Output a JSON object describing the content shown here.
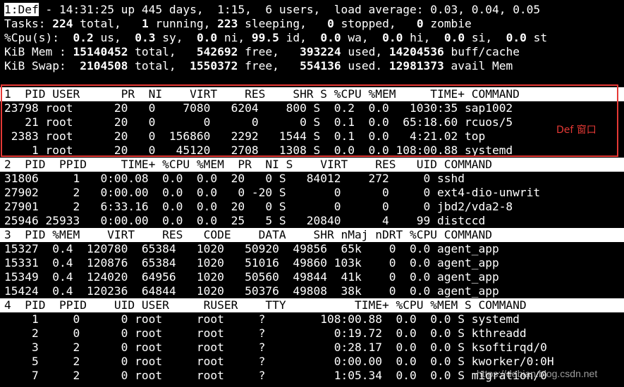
{
  "summary": {
    "top_tag": "1:Def",
    "top_rest": " - 14:31:25 up 445 days,  1:15,  6 users,  load average: 0.03, 0.04, 0.05",
    "tasks": [
      "Tasks: ",
      "224",
      " total,   ",
      "1",
      " running, ",
      "223",
      " sleeping,   ",
      "0",
      " stopped,   ",
      "0",
      " zombie"
    ],
    "cpu": [
      "%Cpu(s):  ",
      "0.2",
      " us,  ",
      "0.3",
      " sy,  ",
      "0.0",
      " ni, ",
      "99.5",
      " id,  ",
      "0.0",
      " wa,  ",
      "0.0",
      " hi,  ",
      "0.0",
      " si,  ",
      "0.0",
      " st"
    ],
    "mem": [
      "KiB Mem : ",
      "15140452",
      " total,   ",
      "542692",
      " free,   ",
      "393224",
      " used, ",
      "14204536",
      " buff/cache"
    ],
    "swap": [
      "KiB Swap:  ",
      "2104508",
      " total,  ",
      "1550372",
      " free,   ",
      "554136",
      " used. ",
      "12981373",
      " avail Mem"
    ]
  },
  "windows": [
    {
      "header": "1  PID USER      PR  NI    VIRT    RES    SHR S %CPU %MEM     TIME+ COMMAND",
      "rows": [
        "23798 root      20   0    7080   6204    800 S  0.2  0.0   1030:35 sap1002",
        "   21 root      20   0       0      0      0 S  0.1  0.0  65:18.60 rcuos/5",
        " 2383 root      20   0  156860   2292   1544 S  0.1  0.0   4:21.02 top",
        "    1 root      20   0   45120   2708   1308 S  0.0  0.0 108:00.88 systemd"
      ]
    },
    {
      "header": "2  PID  PPID     TIME+ %CPU %MEM  PR  NI S    VIRT    RES   UID COMMAND",
      "rows": [
        "31806     1   0:00.08  0.0  0.0  20   0 S   84012    272     0 sshd",
        "27902     2   0:00.00  0.0  0.0   0 -20 S       0      0     0 ext4-dio-unwrit",
        "27901     2   6:33.16  0.0  0.0  20   0 S       0      0     0 jbd2/vda2-8",
        "25946 25933   0:00.00  0.0  0.0  25   5 S   20840      4    99 distccd"
      ]
    },
    {
      "header": "3  PID %MEM    VIRT    RES   CODE    DATA    SHR nMaj nDRT %CPU COMMAND",
      "rows": [
        "15327  0.4  120780  65384   1020   50920  49856  65k    0  0.0 agent_app",
        "15331  0.4  120876  65384   1020   51016  49860 103k    0  0.0 agent_app",
        "15349  0.4  124020  64956   1020   50560  49844  41k    0  0.0 agent_app",
        "15424  0.4  120236  64844   1020   50376  49808  38k    0  0.0 agent_app"
      ]
    },
    {
      "header": "4  PID  PPID    UID USER     RUSER    TTY          TIME+ %CPU %MEM S COMMAND",
      "rows": [
        "    1     0      0 root     root     ?        108:00.88  0.0  0.0 S systemd",
        "    2     0      0 root     root     ?          0:19.72  0.0  0.0 S kthreadd",
        "    3     2      0 root     root     ?          0:28.17  0.0  0.0 S ksoftirqd/0",
        "    5     2      0 root     root     ?          0:00.00  0.0  0.0 S kworker/0:0H",
        "    7     2      0 root     root     ?          1:05.34  0.0  0.0 S migration/0"
      ]
    }
  ],
  "annotation": "Def 窗口",
  "watermark": "https://debian.blog.csdn.net"
}
